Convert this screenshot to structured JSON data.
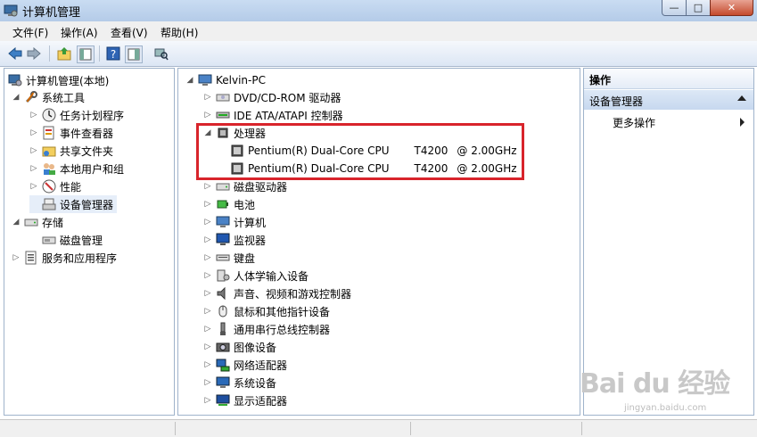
{
  "window": {
    "title": "计算机管理",
    "controls": {
      "minimize": "—",
      "maximize": "□",
      "close": "✕"
    }
  },
  "menu": [
    "文件(F)",
    "操作(A)",
    "查看(V)",
    "帮助(H)"
  ],
  "toolbar": {
    "icons": [
      "back-icon",
      "forward-icon",
      "up-folder-icon",
      "show-tree-icon",
      "help-icon",
      "properties-icon",
      "scan-hardware-icon"
    ]
  },
  "left_tree": {
    "root": "计算机管理(本地)",
    "items": [
      {
        "label": "系统工具",
        "icon": "tools-icon"
      },
      {
        "label": "任务计划程序",
        "icon": "clock-icon"
      },
      {
        "label": "事件查看器",
        "icon": "event-viewer-icon"
      },
      {
        "label": "共享文件夹",
        "icon": "shared-folder-icon"
      },
      {
        "label": "本地用户和组",
        "icon": "users-icon"
      },
      {
        "label": "性能",
        "icon": "performance-icon"
      },
      {
        "label": "设备管理器",
        "icon": "device-manager-icon"
      },
      {
        "label": "存储",
        "icon": "storage-icon"
      },
      {
        "label": "磁盘管理",
        "icon": "disk-management-icon"
      },
      {
        "label": "服务和应用程序",
        "icon": "services-icon"
      }
    ]
  },
  "device_tree": {
    "root": "Kelvin-PC",
    "categories": [
      {
        "label": "DVD/CD-ROM 驱动器",
        "icon": "dvd-drive-icon"
      },
      {
        "label": "IDE ATA/ATAPI 控制器",
        "icon": "ide-controller-icon"
      },
      {
        "label": "处理器",
        "icon": "processor-icon"
      },
      {
        "label": "磁盘驱动器",
        "icon": "disk-drive-icon"
      },
      {
        "label": "电池",
        "icon": "battery-icon"
      },
      {
        "label": "计算机",
        "icon": "computer-icon"
      },
      {
        "label": "监视器",
        "icon": "monitor-icon"
      },
      {
        "label": "键盘",
        "icon": "keyboard-icon"
      },
      {
        "label": "人体学输入设备",
        "icon": "hid-icon"
      },
      {
        "label": "声音、视频和游戏控制器",
        "icon": "sound-icon"
      },
      {
        "label": "鼠标和其他指针设备",
        "icon": "mouse-icon"
      },
      {
        "label": "通用串行总线控制器",
        "icon": "usb-icon"
      },
      {
        "label": "图像设备",
        "icon": "camera-icon"
      },
      {
        "label": "网络适配器",
        "icon": "network-icon"
      },
      {
        "label": "系统设备",
        "icon": "system-devices-icon"
      },
      {
        "label": "显示适配器",
        "icon": "display-adapter-icon"
      }
    ],
    "processors": [
      {
        "name": "Pentium(R) Dual-Core CPU",
        "model": "T4200",
        "speed": "@ 2.00GHz"
      },
      {
        "name": "Pentium(R) Dual-Core CPU",
        "model": "T4200",
        "speed": "@ 2.00GHz"
      }
    ]
  },
  "actions": {
    "title": "操作",
    "section": "设备管理器",
    "more": "更多操作"
  },
  "watermark": {
    "logo": "Bai du 经验",
    "url": "jingyan.baidu.com"
  },
  "colors": {
    "highlight_border": "#d8242b",
    "pane_border": "#9fb3cb"
  }
}
